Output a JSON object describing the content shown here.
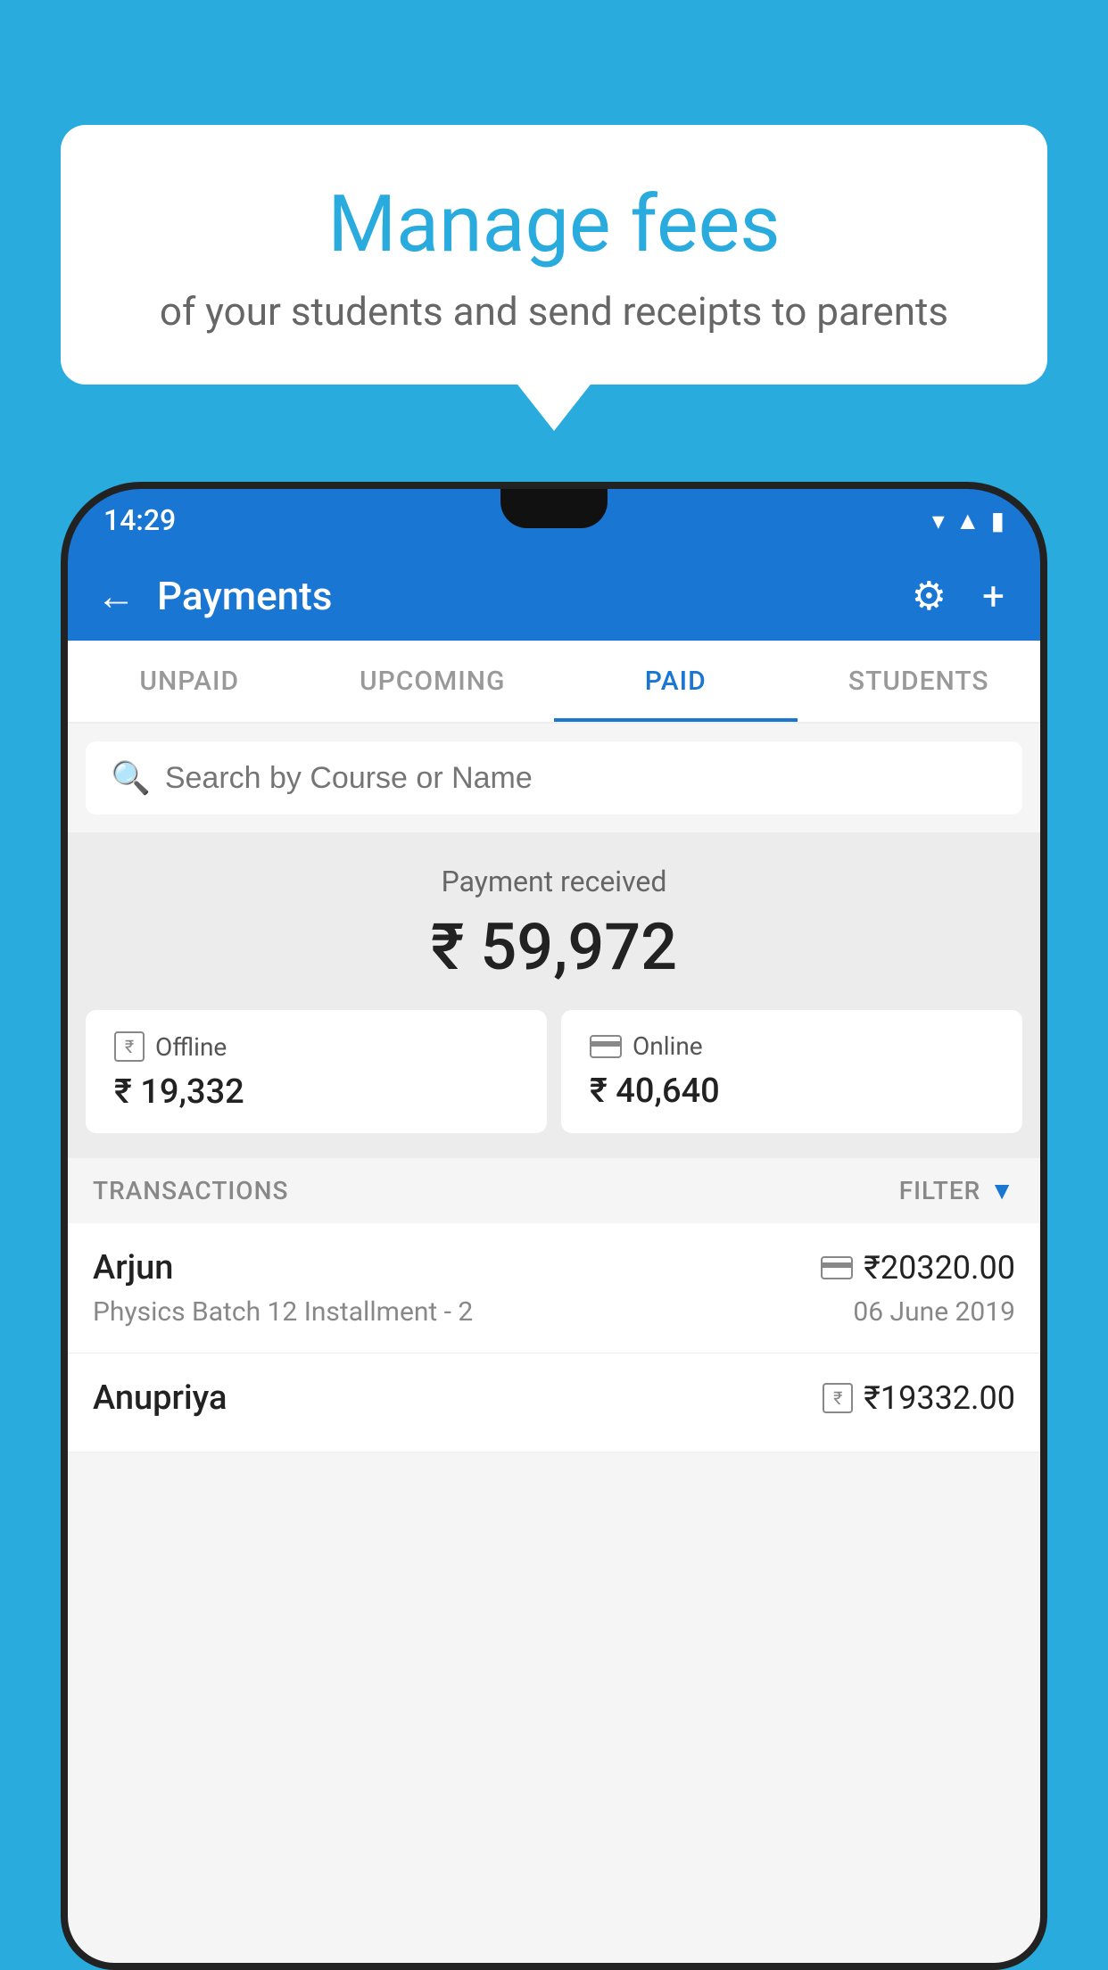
{
  "background_color": "#29ABDE",
  "speech_bubble": {
    "title": "Manage fees",
    "subtitle": "of your students and send receipts to parents"
  },
  "status_bar": {
    "time": "14:29",
    "icons": [
      "wifi",
      "signal",
      "battery"
    ]
  },
  "app_bar": {
    "title": "Payments",
    "back_label": "←",
    "settings_label": "⚙",
    "add_label": "+"
  },
  "tabs": [
    {
      "id": "unpaid",
      "label": "UNPAID",
      "active": false
    },
    {
      "id": "upcoming",
      "label": "UPCOMING",
      "active": false
    },
    {
      "id": "paid",
      "label": "PAID",
      "active": true
    },
    {
      "id": "students",
      "label": "STUDENTS",
      "active": false
    }
  ],
  "search": {
    "placeholder": "Search by Course or Name"
  },
  "payment_summary": {
    "label": "Payment received",
    "amount": "₹ 59,972",
    "offline": {
      "icon": "rupee-box",
      "label": "Offline",
      "amount": "₹ 19,332"
    },
    "online": {
      "icon": "card",
      "label": "Online",
      "amount": "₹ 40,640"
    }
  },
  "transactions_section": {
    "label": "TRANSACTIONS",
    "filter_label": "FILTER"
  },
  "transactions": [
    {
      "name": "Arjun",
      "course": "Physics Batch 12 Installment - 2",
      "amount": "₹20320.00",
      "date": "06 June 2019",
      "payment_type": "card"
    },
    {
      "name": "Anupriya",
      "course": "",
      "amount": "₹19332.00",
      "date": "",
      "payment_type": "rupee"
    }
  ]
}
